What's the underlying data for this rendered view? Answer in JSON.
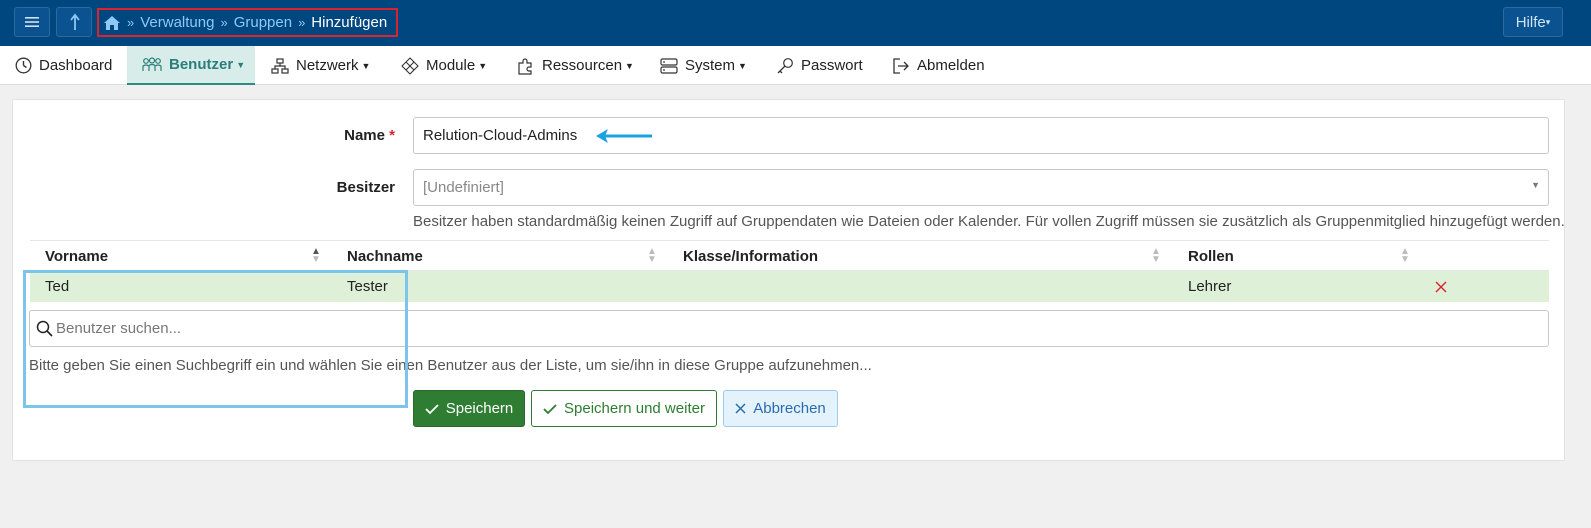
{
  "topbar": {
    "menu_icon": "hamburger-icon",
    "up_icon": "arrow-up-icon",
    "breadcrumb": {
      "home_icon": "home-icon",
      "items": [
        "Verwaltung",
        "Gruppen"
      ],
      "current": "Hinzufügen",
      "separator": "»"
    },
    "help_label": "Hilfe"
  },
  "nav": {
    "items": [
      {
        "label": "Dashboard",
        "icon": "dashboard-icon",
        "dropdown": false
      },
      {
        "label": "Benutzer",
        "icon": "users-icon",
        "dropdown": true,
        "active": true
      },
      {
        "label": "Netzwerk",
        "icon": "network-icon",
        "dropdown": true
      },
      {
        "label": "Module",
        "icon": "module-icon",
        "dropdown": true
      },
      {
        "label": "Ressourcen",
        "icon": "puzzle-icon",
        "dropdown": true
      },
      {
        "label": "System",
        "icon": "server-icon",
        "dropdown": true
      },
      {
        "label": "Passwort",
        "icon": "key-icon",
        "dropdown": false
      },
      {
        "label": "Abmelden",
        "icon": "logout-icon",
        "dropdown": false
      }
    ]
  },
  "form": {
    "name_label": "Name",
    "required_mark": "*",
    "name_value": "Relution-Cloud-Admins",
    "owner_label": "Besitzer",
    "owner_value": "[Undefiniert]",
    "owner_help": "Besitzer haben standardmäßig keinen Zugriff auf Gruppendaten wie Dateien oder Kalender. Für vollen Zugriff müssen sie zusätzlich als Gruppenmitglied hinzugefügt werden."
  },
  "table": {
    "columns": [
      "Vorname",
      "Nachname",
      "Klasse/Information",
      "Rollen"
    ],
    "rows": [
      {
        "vorname": "Ted",
        "nachname": "Tester",
        "klasse": "",
        "rollen": "Lehrer"
      }
    ],
    "remove_icon": "close-icon"
  },
  "search": {
    "placeholder": "Benutzer suchen...",
    "help": "Bitte geben Sie einen Suchbegriff ein und wählen Sie einen Benutzer aus der Liste, um sie/ihn in diese Gruppe aufzunehmen..."
  },
  "buttons": {
    "save": "Speichern",
    "save_next": "Speichern und weiter",
    "cancel": "Abbrechen"
  },
  "colors": {
    "topbar": "#00467f",
    "accent": "#2e8b86",
    "success": "#2e7d32",
    "row_highlight": "#dff0d8",
    "annotation_red": "#d9232e",
    "annotation_blue": "#7cc4ea",
    "arrow": "#1aa3e0"
  }
}
